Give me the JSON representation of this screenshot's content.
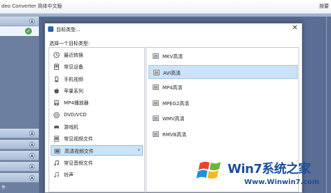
{
  "app": {
    "title": "deo Converter 简体中文版",
    "topright": "按要",
    "footer_text": "件"
  },
  "dialog": {
    "title": "目标类型...",
    "close_glyph": "✕",
    "prompt": "选择一个目标类型:",
    "categories": [
      {
        "label": "最近转换",
        "icon": "clock-icon",
        "selected": false
      },
      {
        "label": "常见设备",
        "icon": "device-icon",
        "selected": false
      },
      {
        "label": "手机视频",
        "icon": "phone-icon",
        "selected": false
      },
      {
        "label": "苹果系列",
        "icon": "apple-icon",
        "selected": false
      },
      {
        "label": "MP4播放器",
        "icon": "mp4-player-icon",
        "selected": false
      },
      {
        "label": "DVD/VCD",
        "icon": "disc-icon",
        "selected": false
      },
      {
        "label": "游戏机",
        "icon": "gamepad-icon",
        "selected": false
      },
      {
        "label": "常见视频文件",
        "icon": "video-file-icon",
        "selected": false
      },
      {
        "label": "高清视频文件",
        "icon": "hd-video-icon",
        "selected": true
      },
      {
        "label": "常见音频文件",
        "icon": "audio-file-icon",
        "selected": false
      },
      {
        "label": "铃声",
        "icon": "ringtone-icon",
        "selected": false
      }
    ],
    "formats": [
      {
        "label": "MKV高清",
        "selected": false
      },
      {
        "label": "AVI高清",
        "selected": true
      },
      {
        "label": "MP4高清",
        "selected": false
      },
      {
        "label": "MPEG2高清",
        "selected": false
      },
      {
        "label": "WMV高清",
        "selected": false
      },
      {
        "label": "RMVB高清",
        "selected": false
      }
    ]
  },
  "watermark": {
    "brand": "Win7系统之家",
    "url": "Www.Winwin7.com"
  },
  "colors": {
    "selection": "#cde3f7",
    "selection_border": "#8fbbe4",
    "brand_blue": "#1c4e9b"
  }
}
